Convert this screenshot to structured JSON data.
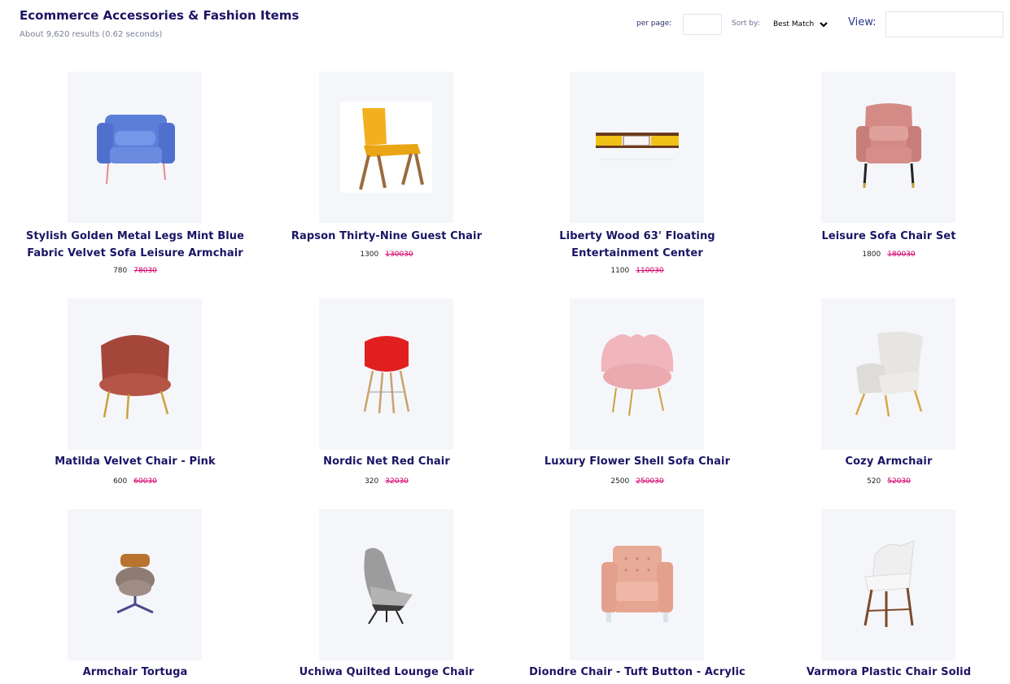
{
  "header": {
    "title": "Ecommerce Accessories & Fashion Items",
    "results": "About 9,620 results (0.62 seconds)",
    "per_page_label": "per page:",
    "per_page_value": "",
    "sort_label": "Sort by:",
    "sort_value": "Best Match",
    "view_label": "View:",
    "view_value": ""
  },
  "products": [
    {
      "name": "Stylish Golden Metal Legs Mint Blue Fabric Velvet Sofa Leisure Armchair",
      "price": "780",
      "old_price": "78030",
      "icon": "blue-armchair"
    },
    {
      "name": "Rapson Thirty-Nine Guest Chair",
      "price": "1300",
      "old_price": "130030",
      "icon": "yellow-chair"
    },
    {
      "name": "Liberty Wood 63' Floating Entertainment Center",
      "price": "1100",
      "old_price": "110030",
      "icon": "floating-shelf"
    },
    {
      "name": "Leisure Sofa Chair Set",
      "price": "1800",
      "old_price": "180030",
      "icon": "pink-wingback-chair"
    },
    {
      "name": "Matilda Velvet Chair - Pink",
      "price": "600",
      "old_price": "60030",
      "icon": "rust-velvet-chair"
    },
    {
      "name": "Nordic Net Red Chair",
      "price": "320",
      "old_price": "32030",
      "icon": "red-eames-chair"
    },
    {
      "name": "Luxury Flower Shell Sofa Chair",
      "price": "2500",
      "old_price": "250030",
      "icon": "pink-shell-chair"
    },
    {
      "name": "Cozy Armchair",
      "price": "520",
      "old_price": "52030",
      "icon": "white-armchair"
    },
    {
      "name": "Armchair Tortuga",
      "price": "",
      "old_price": "",
      "icon": "swivel-armchair"
    },
    {
      "name": "Uchiwa Quilted Lounge Chair",
      "price": "",
      "old_price": "",
      "icon": "grey-lounge-chair"
    },
    {
      "name": "Diondre Chair - Tuft Button - Acrylic Legs",
      "price": "",
      "old_price": "",
      "icon": "peach-club-chair"
    },
    {
      "name": "Varmora Plastic Chair Solid",
      "price": "",
      "old_price": "",
      "icon": "white-plastic-chair"
    }
  ],
  "colors": {
    "title": "#1b1464",
    "old_price": "#d4006a",
    "card_bg": "#f5f6fa"
  }
}
